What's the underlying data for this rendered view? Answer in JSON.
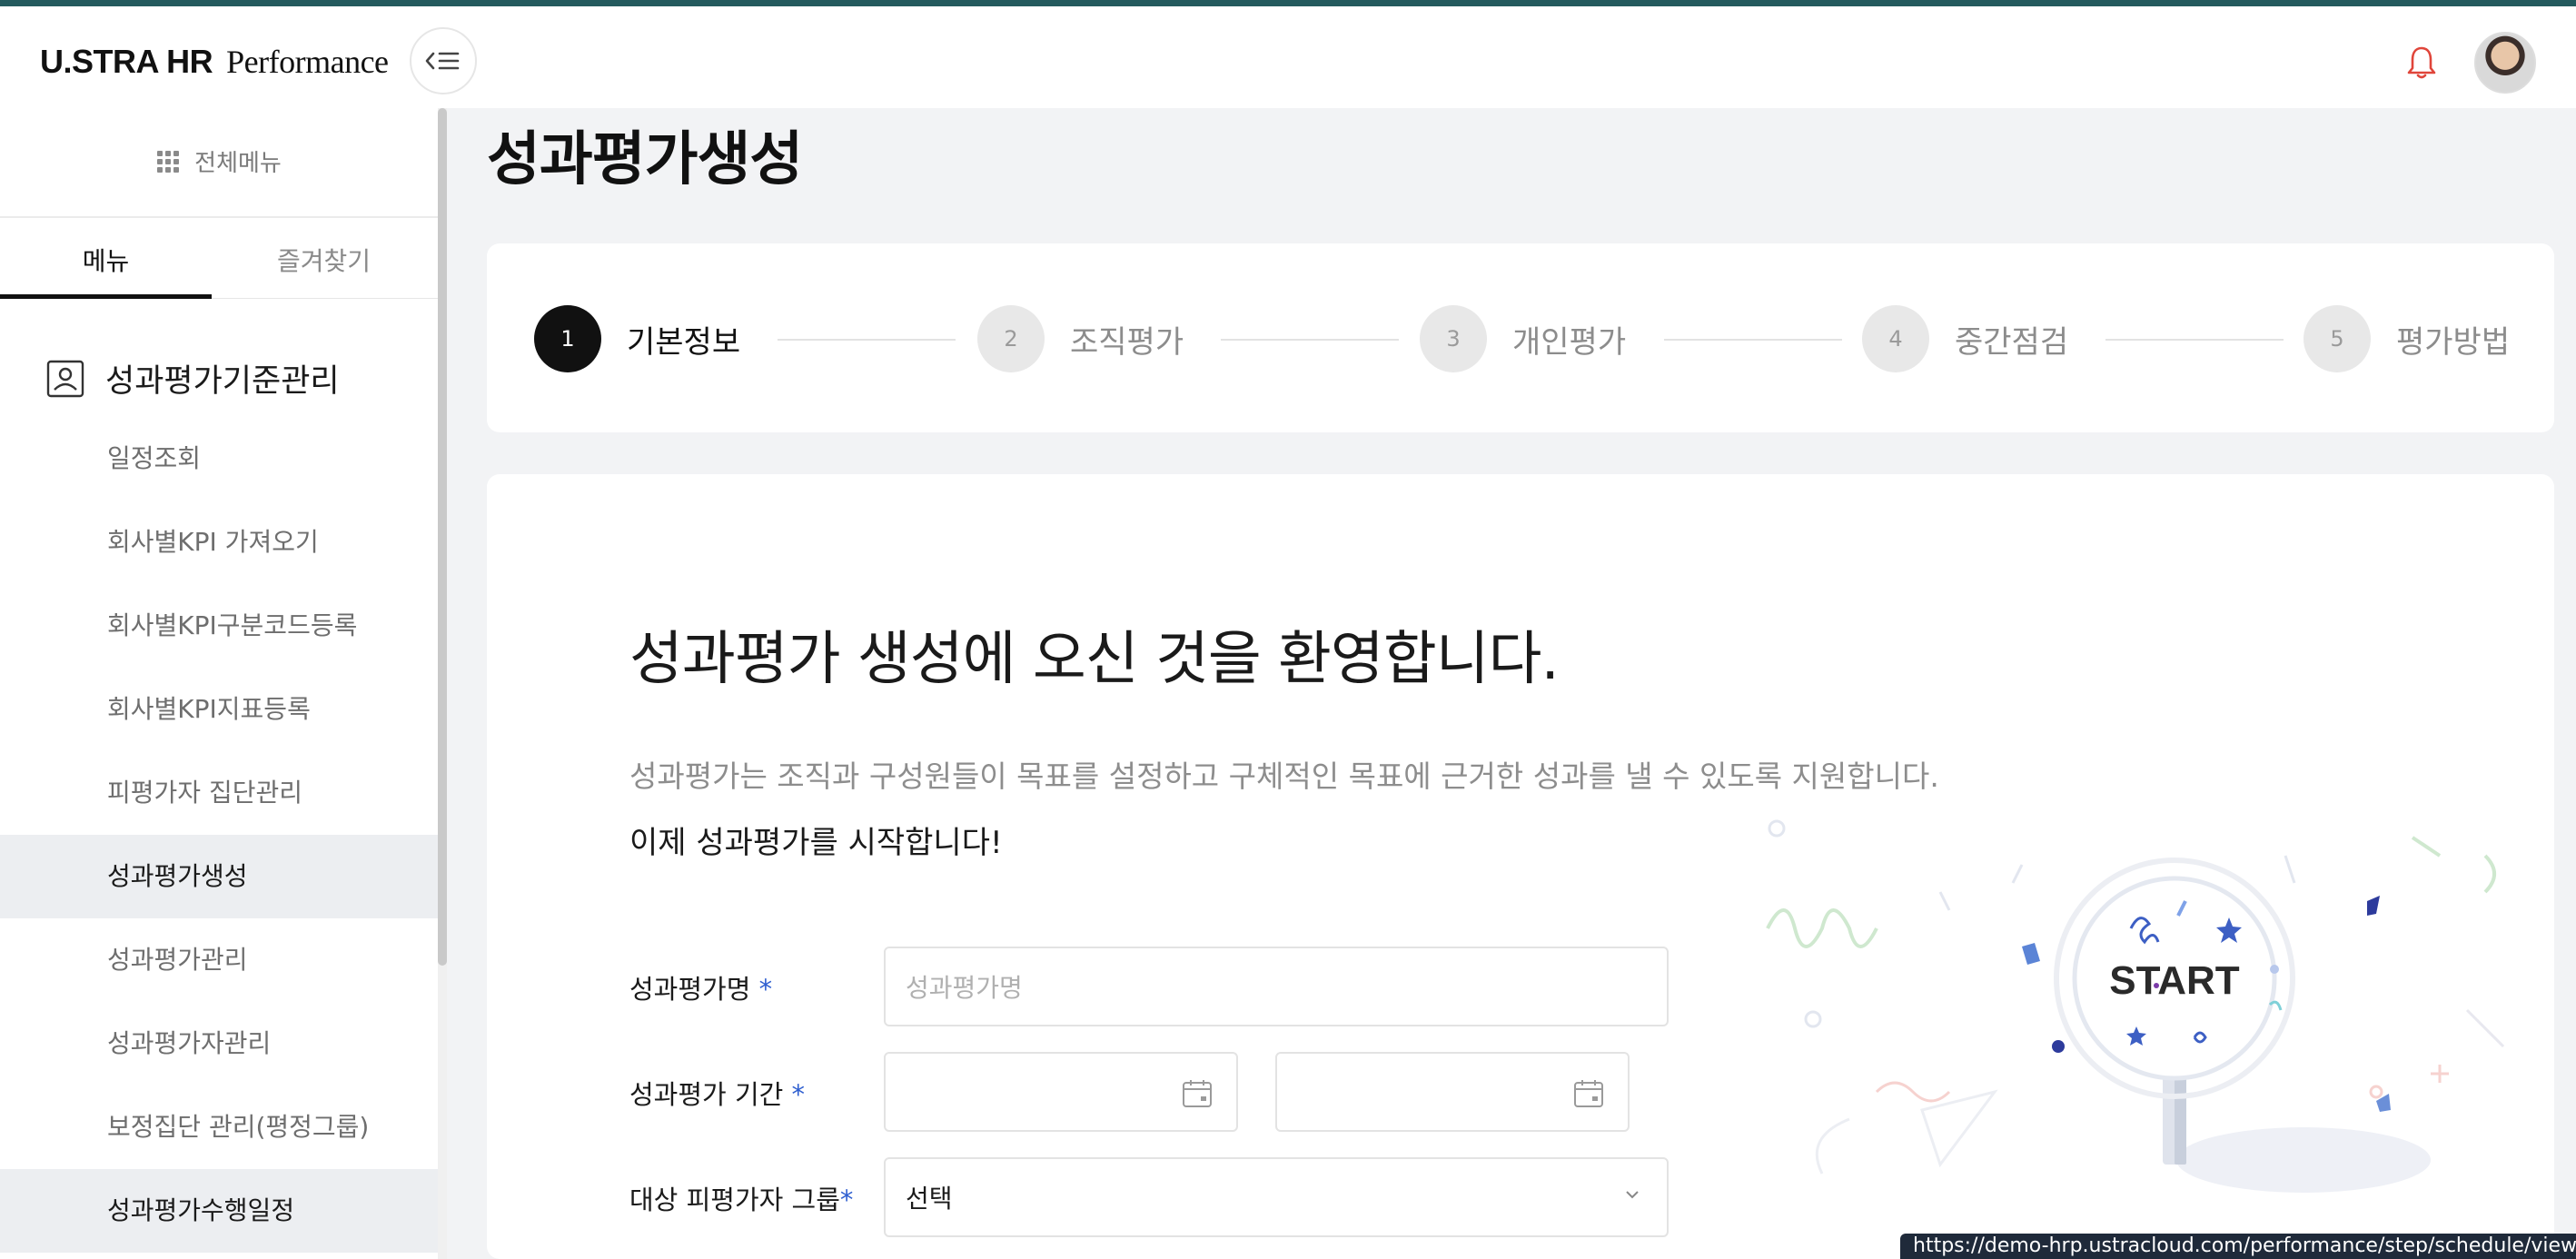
{
  "header": {
    "logo_brand": "U.STRA HR",
    "logo_product": "Performance"
  },
  "sidebar": {
    "all_menu_label": "전체메뉴",
    "tabs": [
      {
        "label": "메뉴",
        "active": true
      },
      {
        "label": "즐겨찾기",
        "active": false
      }
    ],
    "section_title": "성과평가기준관리",
    "items": [
      {
        "label": "일정조회"
      },
      {
        "label": "회사별KPI 가져오기"
      },
      {
        "label": "회사별KPI구분코드등록"
      },
      {
        "label": "회사별KPI지표등록"
      },
      {
        "label": "피평가자 집단관리"
      },
      {
        "label": "성과평가생성",
        "active": true
      },
      {
        "label": "성과평가관리"
      },
      {
        "label": "성과평가자관리"
      },
      {
        "label": "보정집단 관리(평정그룹)"
      },
      {
        "label": "성과평가수행일정"
      }
    ]
  },
  "page": {
    "title": "성과평가생성"
  },
  "stepper": {
    "steps": [
      {
        "num": "1",
        "label": "기본정보",
        "active": true
      },
      {
        "num": "2",
        "label": "조직평가",
        "active": false
      },
      {
        "num": "3",
        "label": "개인평가",
        "active": false
      },
      {
        "num": "4",
        "label": "중간점검",
        "active": false
      },
      {
        "num": "5",
        "label": "평가방법",
        "active": false
      }
    ]
  },
  "content": {
    "welcome": "성과평가 생성에 오신 것을 환영합니다.",
    "description": "성과평가는 조직과 구성원들이 목표를 설정하고 구체적인 목표에 근거한 성과를 낼 수 있도록 지원합니다.",
    "cta": "이제 성과평가를 시작합니다!",
    "illustration_text": "START"
  },
  "form": {
    "name_label": "성과평가명",
    "name_placeholder": "성과평가명",
    "period_label": "성과평가 기간",
    "group_label": "대상 피평가자 그룹",
    "group_value": "선택",
    "required_mark": "*"
  },
  "statusbar": {
    "url": "https://demo-hrp.ustracloud.com/performance/step/schedule/view"
  },
  "colors": {
    "topline": "#245a5e",
    "required": "#2f5fd0",
    "bell": "#e0453a"
  }
}
